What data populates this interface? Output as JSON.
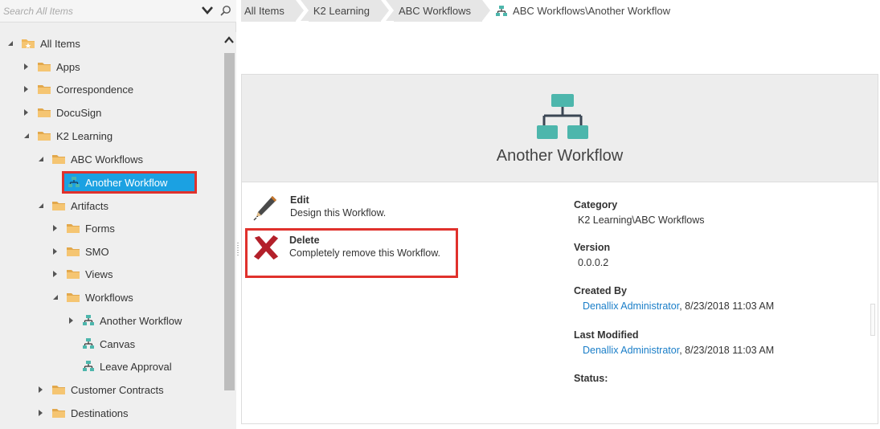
{
  "search": {
    "placeholder": "Search All Items"
  },
  "tree": {
    "items": [
      {
        "label": "All Items",
        "type": "root"
      },
      {
        "label": "Apps",
        "type": "folder"
      },
      {
        "label": "Correspondence",
        "type": "folder"
      },
      {
        "label": "DocuSign",
        "type": "folder"
      },
      {
        "label": "K2 Learning",
        "type": "folder"
      },
      {
        "label": "ABC Workflows",
        "type": "folder"
      },
      {
        "label": "Another Workflow",
        "type": "workflow",
        "selected": true
      },
      {
        "label": "Artifacts",
        "type": "folder"
      },
      {
        "label": "Forms",
        "type": "folder"
      },
      {
        "label": "SMO",
        "type": "folder"
      },
      {
        "label": "Views",
        "type": "folder"
      },
      {
        "label": "Workflows",
        "type": "folder"
      },
      {
        "label": "Another Workflow",
        "type": "workflow"
      },
      {
        "label": "Canvas",
        "type": "workflow"
      },
      {
        "label": "Leave Approval",
        "type": "workflow"
      },
      {
        "label": "Customer Contracts",
        "type": "folder"
      },
      {
        "label": "Destinations",
        "type": "folder"
      }
    ]
  },
  "breadcrumb": {
    "items": [
      "All Items",
      "K2 Learning",
      "ABC Workflows"
    ],
    "current": "ABC Workflows\\Another Workflow"
  },
  "card": {
    "title": "Another Workflow",
    "actions": {
      "edit": {
        "title": "Edit",
        "desc": "Design this Workflow."
      },
      "delete": {
        "title": "Delete",
        "desc": "Completely remove this Workflow."
      }
    },
    "properties": {
      "category": {
        "label": "Category",
        "value": "K2 Learning\\ABC Workflows"
      },
      "version": {
        "label": "Version",
        "value": "0.0.0.2"
      },
      "created_by": {
        "label": "Created By",
        "user": "Denallix Administrator",
        "date": ", 8/23/2018 11:03 AM"
      },
      "last_modified": {
        "label": "Last Modified",
        "user": "Denallix Administrator",
        "date": ", 8/23/2018 11:03 AM"
      },
      "status": {
        "label": "Status:"
      }
    }
  },
  "colors": {
    "accent": "#1ba1e2",
    "highlight": "#e0312c",
    "workflow_icon": "#4db6ac",
    "folder": "#f0b75a",
    "link": "#1a7ec8"
  },
  "icons": {
    "search": "magnifier-icon",
    "dropdown": "chevron-down-icon",
    "folder": "folder-icon",
    "workflow": "workflow-icon",
    "edit": "pencil-icon",
    "delete": "red-x-icon"
  }
}
